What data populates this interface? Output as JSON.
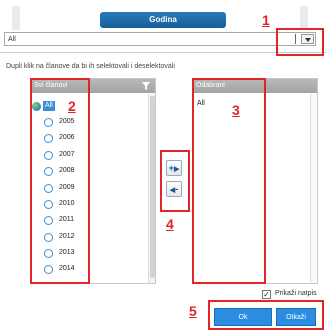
{
  "dialog": {
    "title": "Godina"
  },
  "dropdown": {
    "value": "All"
  },
  "instructions": "Dupli klik na članove da bi ih selektovali i deselektovali",
  "left_list": {
    "header": "Svi članovi",
    "root_item": "All",
    "items": [
      "2005",
      "2006",
      "2007",
      "2008",
      "2009",
      "2010",
      "2011",
      "2012",
      "2013",
      "2014"
    ]
  },
  "right_list": {
    "header": "Odabrani",
    "items": [
      "All"
    ]
  },
  "move_buttons": {
    "add_label": "+",
    "remove_label": "-"
  },
  "show_caption": {
    "label": "Prikaži natpis",
    "checked": "✓"
  },
  "buttons": {
    "ok": "Ok",
    "cancel": "Otkaži"
  },
  "annotations": [
    "1",
    "2",
    "3",
    "4",
    "5"
  ],
  "colors": {
    "accent": "#2a8de0",
    "annotation": "#e2242b",
    "header": "#16609b"
  }
}
